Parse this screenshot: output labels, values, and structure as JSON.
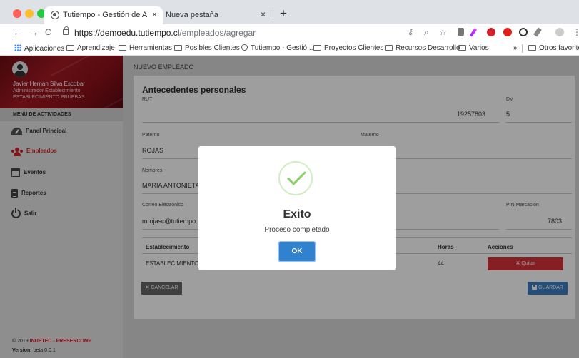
{
  "browser": {
    "tabs": [
      {
        "title": "Tutiempo - Gestión de Asistencia",
        "close": "×"
      },
      {
        "title": "Nueva pestaña",
        "close": "×"
      }
    ],
    "new_tab": "+",
    "url_host": "https://demoedu.tutiempo.cl",
    "url_path": "/empleados/agregar",
    "nav": {
      "back": "←",
      "forward": "→",
      "reload": "C"
    },
    "bookmarks": [
      "Aplicaciones",
      "Aprendizaje",
      "Herramientas",
      "Posibles Clientes",
      "Tutiempo - Gestió...",
      "Proyectos Clientes",
      "Recursos Desarrollo",
      "Varios"
    ],
    "bookmarks_more": "»",
    "bookmarks_other": "Otros favoritos"
  },
  "sidebar": {
    "user_name": "Javier Hernan Silva Escobar",
    "user_role": "Administrador Establecimiento",
    "user_establishment": "ESTABLECIMIENTO PRUEBAS",
    "menu_heading": "MENU DE ACTIVIDADES",
    "items": [
      {
        "label": "Panel Principal",
        "icon": "dashboard-icon"
      },
      {
        "label": "Empleados",
        "icon": "users-icon",
        "active": true
      },
      {
        "label": "Eventos",
        "icon": "calendar-icon"
      },
      {
        "label": "Reportes",
        "icon": "file-icon"
      },
      {
        "label": "Salir",
        "icon": "power-icon"
      }
    ],
    "footer_copy": "© 2019",
    "footer_brand": "INDETEC - PRESERCOMP",
    "footer_version_label": "Version:",
    "footer_version": "beta 0.0.1"
  },
  "page": {
    "breadcrumb": "NUEVO EMPLEADO",
    "section_title": "Antecedentes personales",
    "fields": {
      "rut_label": "RUT",
      "rut_value": "19257803",
      "dv_label": "DV",
      "dv_value": "5",
      "paterno_label": "Paterno",
      "paterno_value": "ROJAS",
      "materno_label": "Materno",
      "nombres_label": "Nombres",
      "nombres_value": "MARIA ANTONIETA",
      "email_label": "Correo Electrónico",
      "email_value": "mrojasc@tutiempo.c",
      "pin_label": "PIN Marcación",
      "pin_value": "7803"
    },
    "table": {
      "headers": [
        "Establecimiento",
        "Horas",
        "Acciones"
      ],
      "row": {
        "establecimiento": "ESTABLECIMIENTO PI",
        "horas": "44",
        "action": "Quitar"
      }
    },
    "cancel_label": "CANCELAR",
    "save_label": "GUARDAR"
  },
  "modal": {
    "title": "Exito",
    "message": "Proceso completado",
    "ok_label": "OK"
  },
  "colors": {
    "accent_red": "#d4202b",
    "save_blue": "#3a7fc0",
    "ok_blue": "#3182ce",
    "success_green": "#8ccf6a"
  }
}
